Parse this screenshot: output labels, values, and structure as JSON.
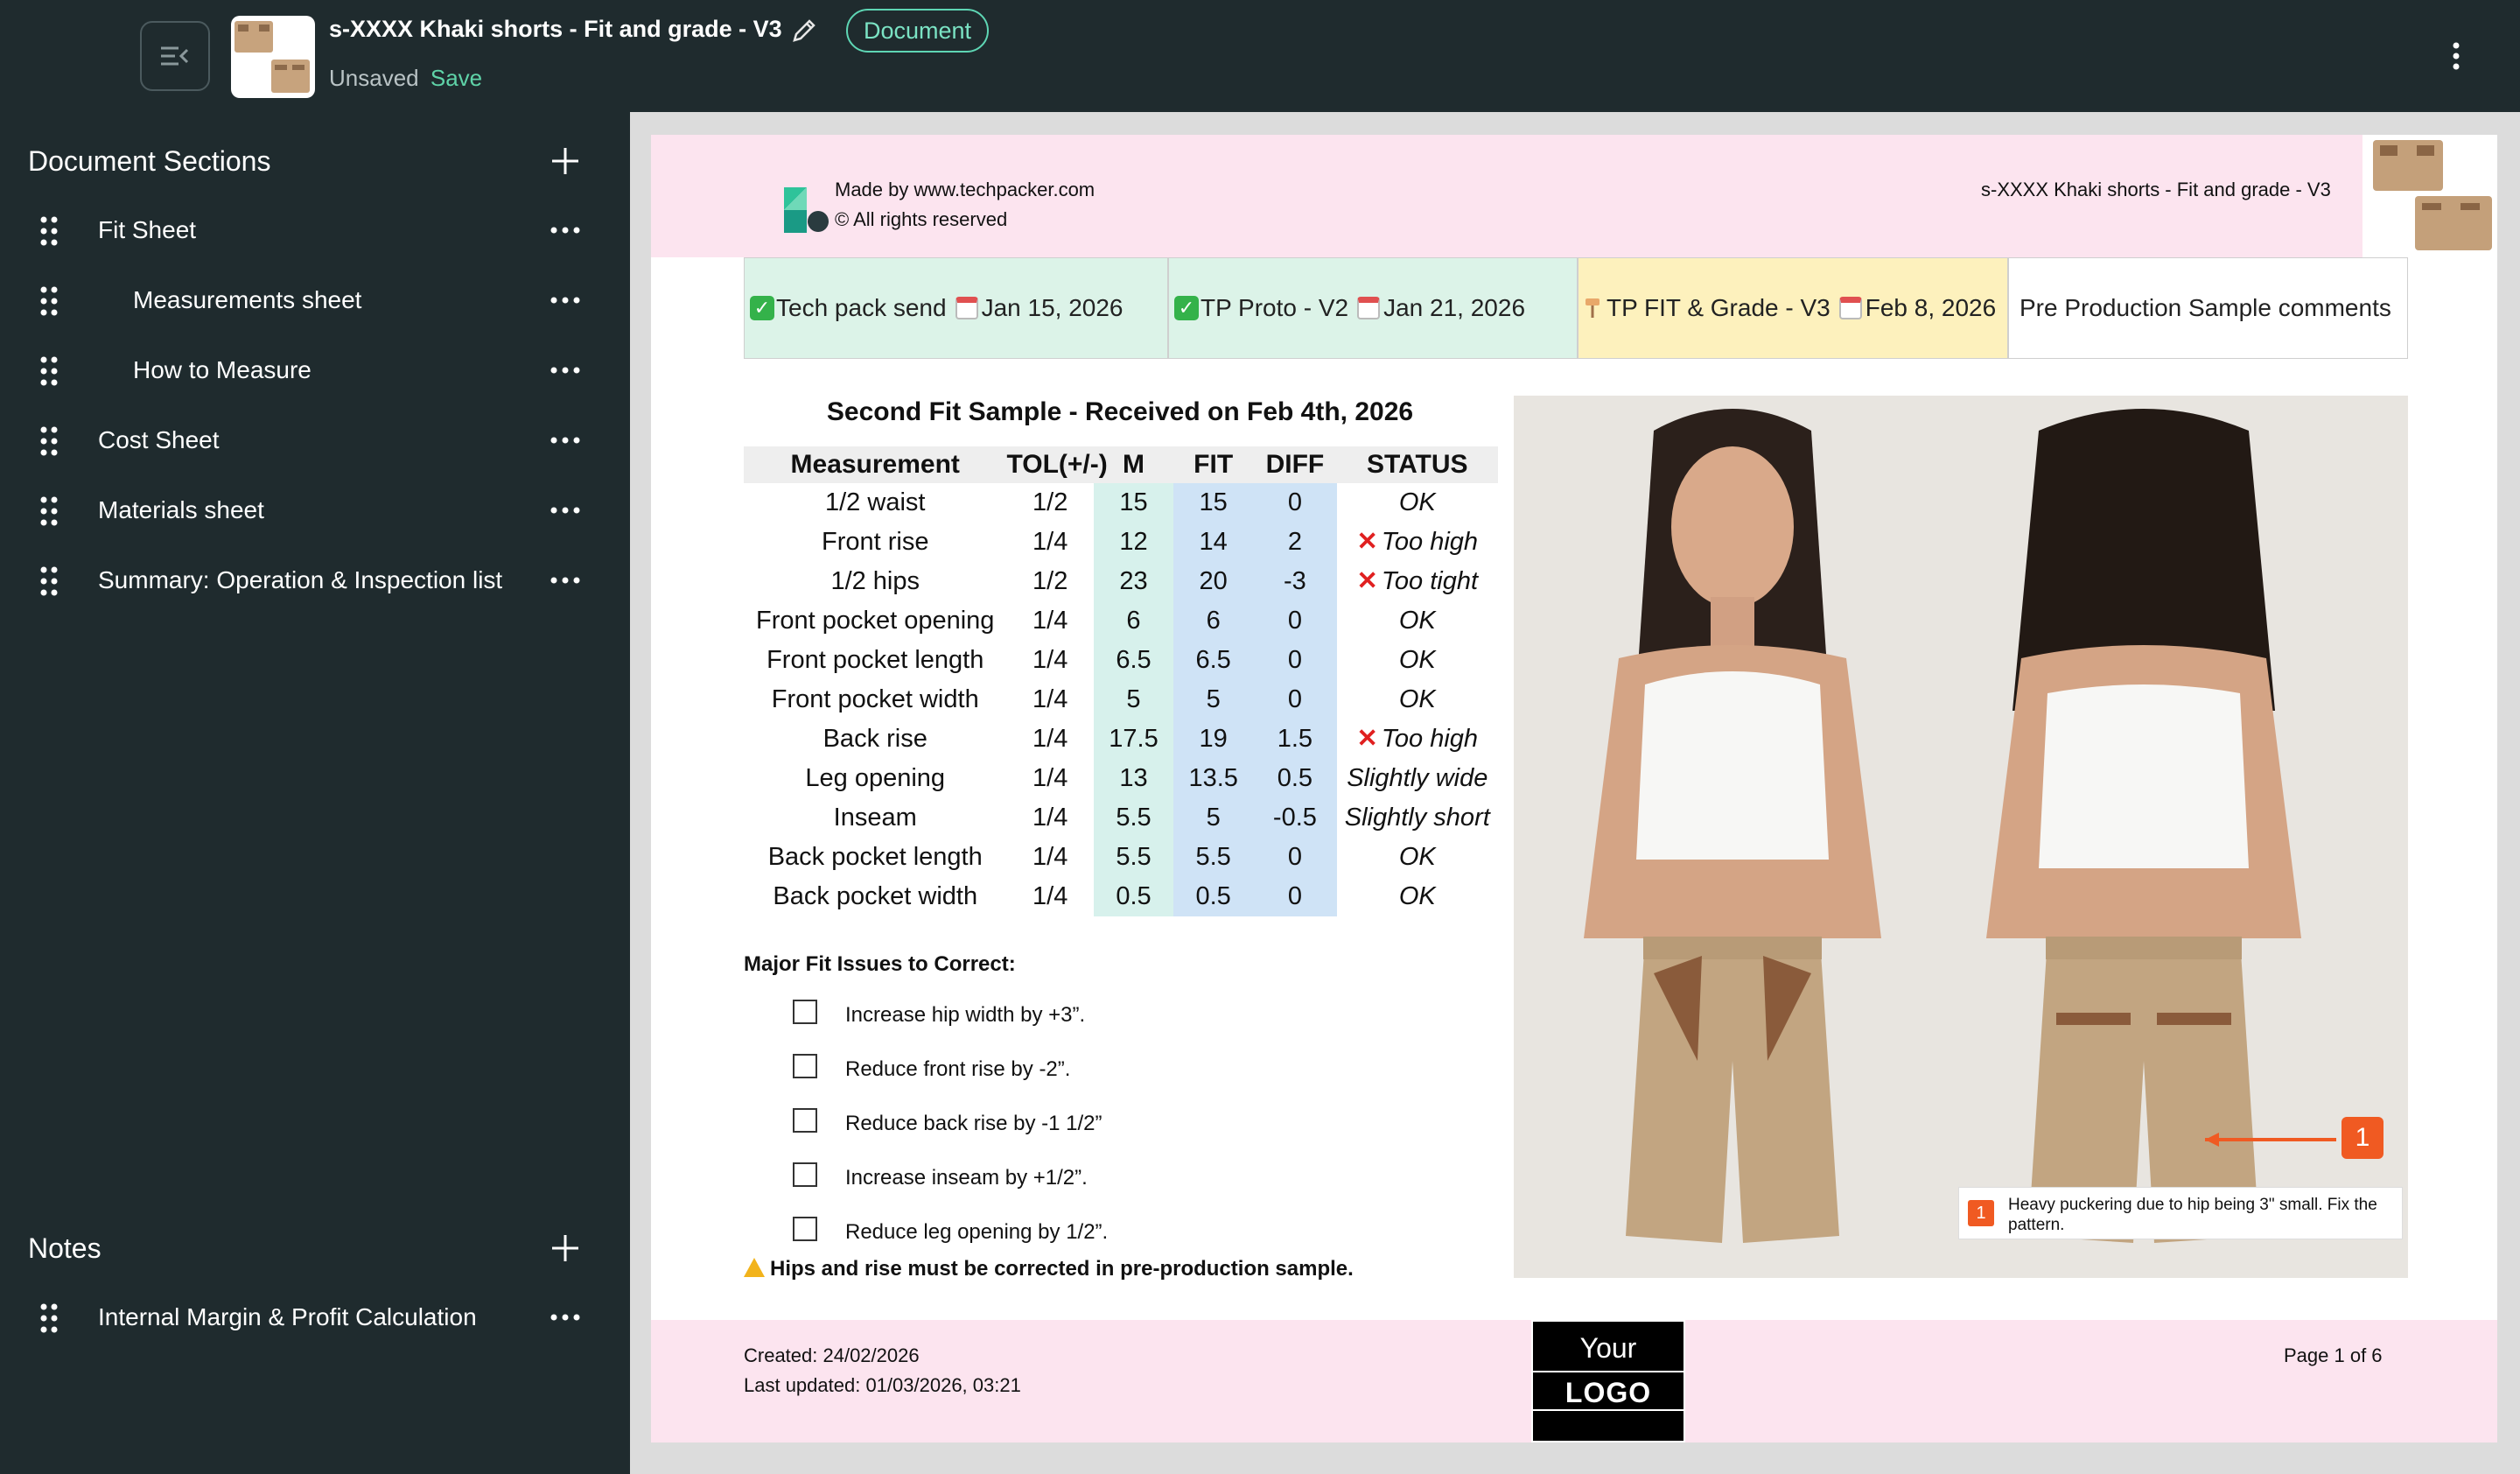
{
  "header": {
    "doc_title": "s-XXXX Khaki shorts - Fit and grade - V3",
    "badge": "Document",
    "save_status": "Unsaved",
    "save_label": "Save"
  },
  "sidebar": {
    "sections_heading": "Document Sections",
    "items": [
      {
        "label": "Fit Sheet"
      },
      {
        "label": "Measurements sheet"
      },
      {
        "label": "How to Measure"
      },
      {
        "label": "Cost Sheet"
      },
      {
        "label": "Materials sheet"
      },
      {
        "label": "Summary: Operation & Inspection list"
      }
    ],
    "notes_heading": "Notes",
    "notes": [
      {
        "label": "Internal Margin & Profit Calculation"
      }
    ]
  },
  "page": {
    "header_made_by": "Made by www.techpacker.com",
    "header_rights": "© All rights reserved",
    "header_title": "s-XXXX Khaki shorts - Fit and grade - V3",
    "status_cells": [
      {
        "label": "Tech pack send",
        "date": "Jan 15, 2026"
      },
      {
        "label": "TP Proto - V2",
        "date": "Jan 21, 2026"
      },
      {
        "label": "TP FIT & Grade - V3",
        "date": "Feb 8, 2026"
      },
      {
        "label": "Pre Production Sample comments"
      }
    ],
    "fit_title": "Second Fit Sample - Received on Feb 4th, 2026",
    "table": {
      "headers": [
        "Measurement",
        "TOL(+/-)",
        "M",
        "FIT",
        "DIFF",
        "STATUS"
      ],
      "rows": [
        {
          "name": "1/2 waist",
          "tol": "1/2",
          "m": "15",
          "fit": "15",
          "diff": "0",
          "status": "OK",
          "flag": false
        },
        {
          "name": "Front rise",
          "tol": "1/4",
          "m": "12",
          "fit": "14",
          "diff": "2",
          "status": "Too high",
          "flag": true
        },
        {
          "name": "1/2 hips",
          "tol": "1/2",
          "m": "23",
          "fit": "20",
          "diff": "-3",
          "status": "Too tight",
          "flag": true
        },
        {
          "name": "Front pocket opening",
          "tol": "1/4",
          "m": "6",
          "fit": "6",
          "diff": "0",
          "status": "OK",
          "flag": false
        },
        {
          "name": "Front pocket length",
          "tol": "1/4",
          "m": "6.5",
          "fit": "6.5",
          "diff": "0",
          "status": "OK",
          "flag": false
        },
        {
          "name": "Front pocket width",
          "tol": "1/4",
          "m": "5",
          "fit": "5",
          "diff": "0",
          "status": "OK",
          "flag": false
        },
        {
          "name": "Back rise",
          "tol": "1/4",
          "m": "17.5",
          "fit": "19",
          "diff": "1.5",
          "status": "Too high",
          "flag": true
        },
        {
          "name": "Leg opening",
          "tol": "1/4",
          "m": "13",
          "fit": "13.5",
          "diff": "0.5",
          "status": "Slightly wide",
          "flag": false
        },
        {
          "name": "Inseam",
          "tol": "1/4",
          "m": "5.5",
          "fit": "5",
          "diff": "-0.5",
          "status": "Slightly short",
          "flag": false
        },
        {
          "name": "Back pocket length",
          "tol": "1/4",
          "m": "5.5",
          "fit": "5.5",
          "diff": "0",
          "status": "OK",
          "flag": false
        },
        {
          "name": "Back pocket width",
          "tol": "1/4",
          "m": "0.5",
          "fit": "0.5",
          "diff": "0",
          "status": "OK",
          "flag": false
        }
      ]
    },
    "issues_heading": "Major Fit Issues to Correct:",
    "issues": [
      "Increase hip width by +3”.",
      "Reduce front rise by -2”.",
      "Reduce back rise by -1 1/2”",
      "Increase inseam by +1/2”.",
      "Reduce leg opening by 1/2”."
    ],
    "warning": "Hips and rise must be corrected in pre-production sample.",
    "photo_marker": "1",
    "photo_note_num": "1",
    "photo_note": "Heavy puckering due to hip being 3\" small. Fix the pattern.",
    "footer_created": "Created: 24/02/2026",
    "footer_updated": "Last updated: 01/03/2026, 03:21",
    "footer_page": "Page 1 of 6",
    "logo_your": "Your",
    "logo_word": "LOGO"
  },
  "colors": {
    "app_bg": "#1f2b2e",
    "accent": "#5fd3a8",
    "header_pink": "#fce4ef",
    "m_column": "#d7f1ec",
    "fit_column": "#cfe3f6",
    "marker_orange": "#f05a22",
    "flag_red": "#e02020"
  },
  "icons": [
    "sidebar-collapse-icon",
    "edit-pencil-icon",
    "more-vertical-icon",
    "plus-icon",
    "drag-handle-icon",
    "more-horizontal-icon",
    "check-icon",
    "calendar-icon",
    "pin-icon",
    "x-mark-icon",
    "checkbox-icon",
    "warning-icon"
  ]
}
